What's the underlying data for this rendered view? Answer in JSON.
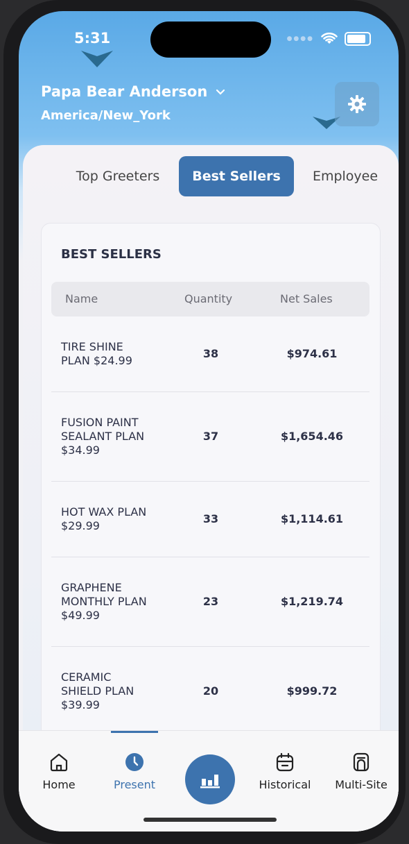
{
  "status_bar": {
    "time": "5:31"
  },
  "header": {
    "user_name": "Papa Bear Anderson",
    "timezone": "America/New_York"
  },
  "tabs": [
    {
      "label": "Top Greeters"
    },
    {
      "label": "Best Sellers",
      "active": true
    },
    {
      "label": "Employee"
    }
  ],
  "table": {
    "title": "BEST SELLERS",
    "columns": [
      "Name",
      "Quantity",
      "Net Sales"
    ],
    "rows": [
      {
        "name_lines": [
          "TIRE SHINE",
          "PLAN $24.99"
        ],
        "quantity": "38",
        "net_sales": "$974.61"
      },
      {
        "name_lines": [
          "FUSION PAINT",
          "SEALANT PLAN",
          "$34.99"
        ],
        "quantity": "37",
        "net_sales": "$1,654.46"
      },
      {
        "name_lines": [
          "HOT WAX PLAN",
          "$29.99"
        ],
        "quantity": "33",
        "net_sales": "$1,114.61"
      },
      {
        "name_lines": [
          "GRAPHENE",
          "MONTHLY PLAN",
          "$49.99"
        ],
        "quantity": "23",
        "net_sales": "$1,219.74"
      },
      {
        "name_lines": [
          "CERAMIC",
          "SHIELD PLAN",
          "$39.99"
        ],
        "quantity": "20",
        "net_sales": "$999.72"
      }
    ]
  },
  "bottom_nav": {
    "home": "Home",
    "present": "Present",
    "historical": "Historical",
    "multi_site": "Multi-Site",
    "active": "Present"
  },
  "colors": {
    "accent": "#3d73ae",
    "header_top": "#5aa9e6"
  }
}
